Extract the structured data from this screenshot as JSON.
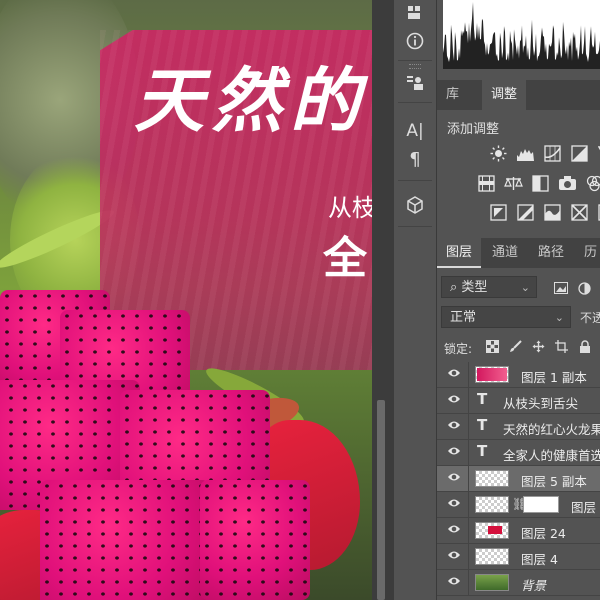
{
  "canvas": {
    "title": "天然的",
    "subtitle_line1": "从枝",
    "subtitle_line2": "全"
  },
  "panels": {
    "tabs_adjust": [
      {
        "label": "库"
      },
      {
        "label": "调整"
      }
    ],
    "adjust_title": "添加调整",
    "tabs_layers": [
      {
        "label": "图层"
      },
      {
        "label": "通道"
      },
      {
        "label": "路径"
      },
      {
        "label": "历"
      }
    ],
    "filter_label": "类型",
    "filter_icon": "search-icon",
    "blend_mode": "正常",
    "opacity_label": "不透",
    "lock_label": "锁定:"
  },
  "layers": [
    {
      "name": "图层 1 副本",
      "kind": "image",
      "thumb": "pink"
    },
    {
      "name": "从枝头到舌尖 ",
      "kind": "text"
    },
    {
      "name": "天然的红心火龙果",
      "kind": "text"
    },
    {
      "name": "全家人的健康首选",
      "kind": "text"
    },
    {
      "name": "图层 5 副本",
      "kind": "image",
      "thumb": "checker",
      "selected": true
    },
    {
      "name": "图层",
      "kind": "masked",
      "thumb": "checker"
    },
    {
      "name": "图层 24",
      "kind": "image",
      "thumb": "red"
    },
    {
      "name": "图层 4",
      "kind": "image",
      "thumb": "checker"
    },
    {
      "name": "背景",
      "kind": "background",
      "thumb": "photo"
    }
  ],
  "colors": {
    "panel_bg": "#535353",
    "selected_layer": "#6b6b6b",
    "pink_overlay": "#cd2664"
  }
}
